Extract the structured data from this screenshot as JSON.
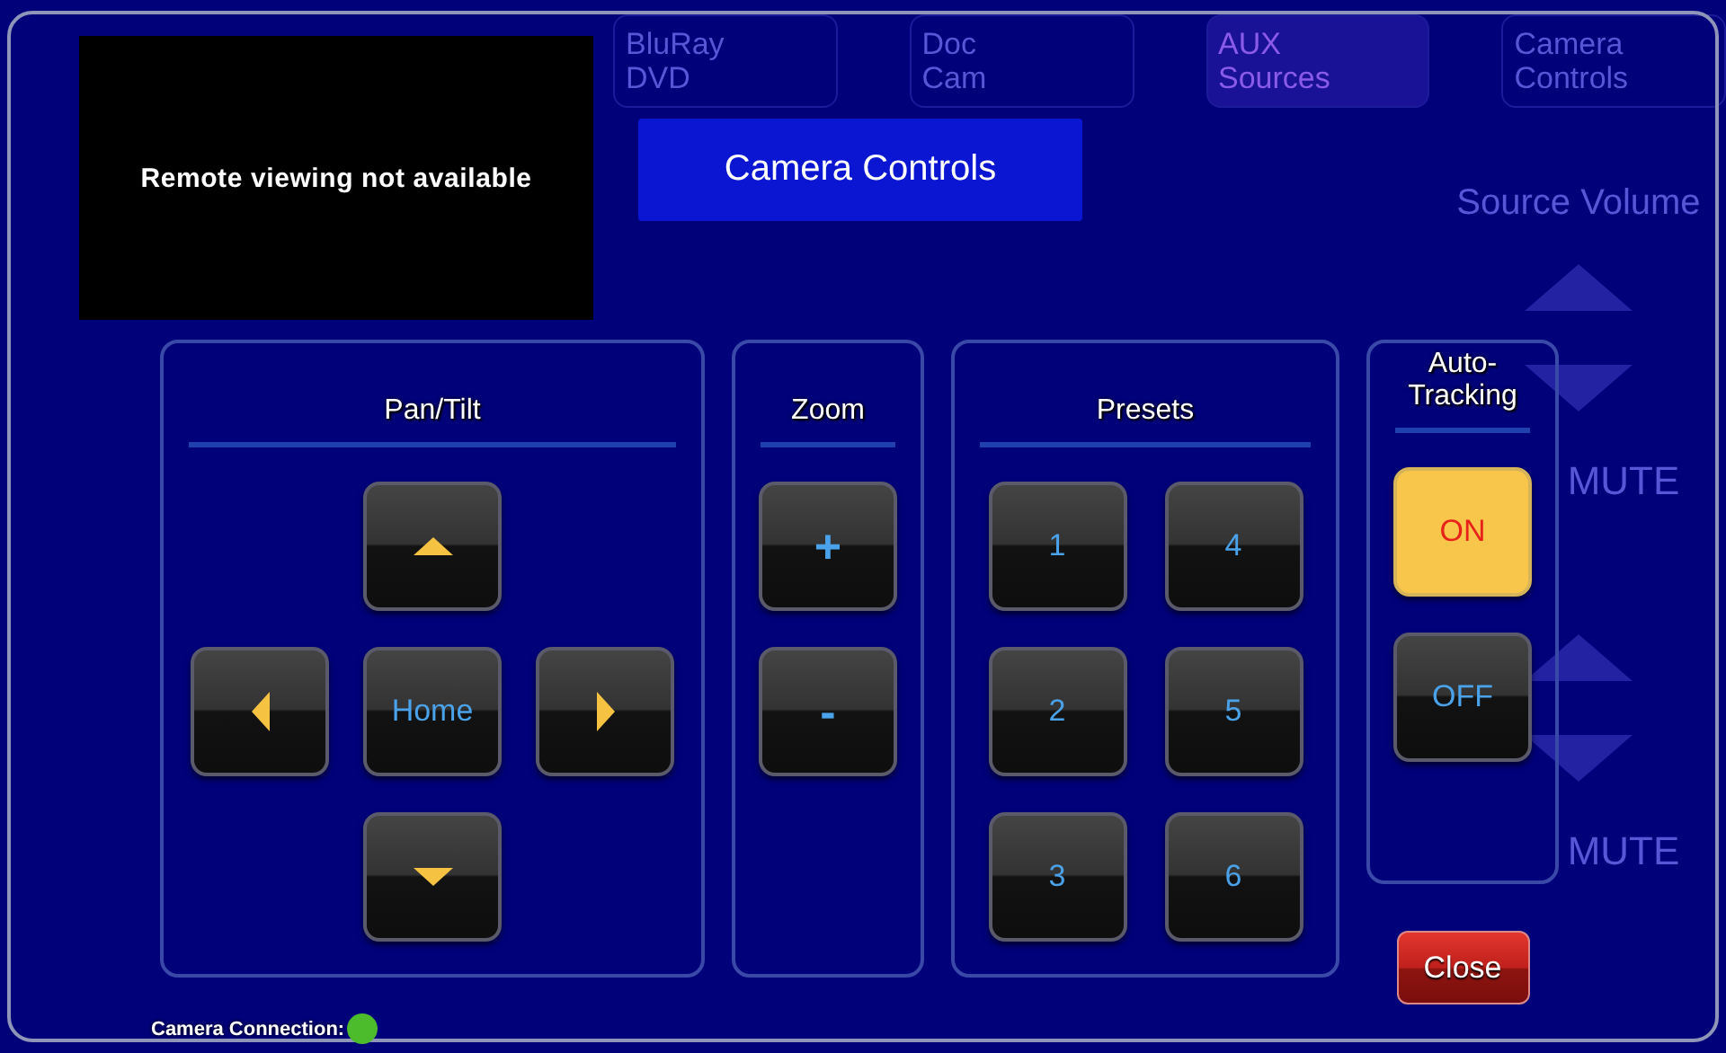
{
  "background": {
    "sources": [
      {
        "label": "BluRay DVD",
        "selected": false
      },
      {
        "label": "Doc Cam",
        "selected": false
      },
      {
        "label": "AUX Sources",
        "selected": true
      },
      {
        "label": "Camera Controls",
        "selected": false
      }
    ],
    "volume_title": "Source Volume",
    "mute_buttons": [
      "MUTE",
      "MUTE"
    ]
  },
  "dialog": {
    "video_message": "Remote viewing not available",
    "title": "Camera Controls",
    "panels": [
      {
        "kind": "pan_tilt",
        "title": "Pan/Tilt",
        "buttons": [
          {
            "kind": "up"
          },
          {
            "kind": "left"
          },
          {
            "kind": "text",
            "label": "Home"
          },
          {
            "kind": "right"
          },
          {
            "kind": "down"
          }
        ]
      },
      {
        "kind": "column",
        "title": "Zoom",
        "buttons": [
          {
            "kind": "text",
            "label": "+"
          },
          {
            "kind": "text",
            "label": "-"
          }
        ]
      },
      {
        "kind": "grid",
        "title": "Presets",
        "buttons": [
          {
            "kind": "text",
            "label": "1"
          },
          {
            "kind": "text",
            "label": "2"
          },
          {
            "kind": "text",
            "label": "3"
          },
          {
            "kind": "text",
            "label": "4"
          },
          {
            "kind": "text",
            "label": "5"
          },
          {
            "kind": "text",
            "label": "6"
          }
        ]
      },
      {
        "kind": "toggle",
        "title": "Auto-Tracking",
        "buttons": [
          {
            "kind": "text",
            "label": "ON",
            "selected": true
          },
          {
            "kind": "text",
            "label": "OFF",
            "selected": false
          }
        ]
      }
    ],
    "close": "Close",
    "connection": {
      "label": "Camera Connection:",
      "connected": true
    }
  }
}
